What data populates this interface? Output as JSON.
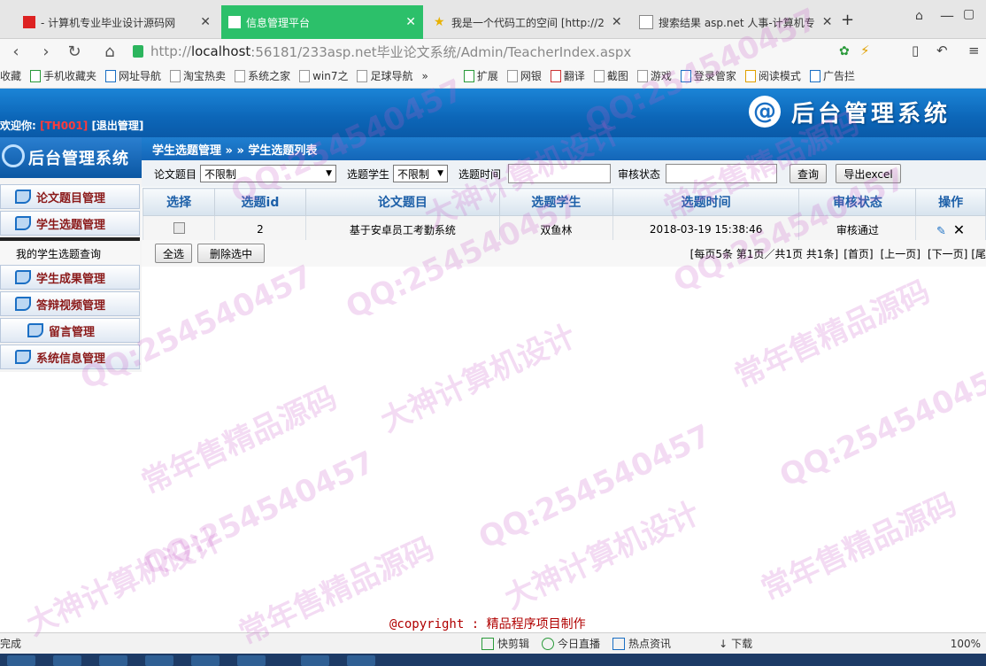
{
  "browser": {
    "tabs": [
      {
        "label": "- 计算机专业毕业设计源码网",
        "active": false
      },
      {
        "label": "信息管理平台",
        "active": true
      },
      {
        "label": "我是一个代码工的空间 [http://2",
        "active": false
      },
      {
        "label": "搜索结果 asp.net 人事-计算机专",
        "active": false
      }
    ],
    "new_tab": "+",
    "url_prefix": "http://",
    "url_host": "localhost",
    "url_rest": ":56181/233asp.net毕业论文系统/Admin/TeacherIndex.aspx",
    "bookmarks": [
      "收藏",
      "手机收藏夹",
      "网址导航",
      "淘宝热卖",
      "系统之家",
      "win7之",
      "足球导航",
      "»"
    ],
    "extensions": [
      "扩展",
      "网银",
      "翻译",
      "截图",
      "游戏",
      "登录管家",
      "阅读模式",
      "广告拦"
    ]
  },
  "header": {
    "welcome_label": "欢迎你:",
    "user_id": "[TH001]",
    "logout": "[退出管理]",
    "system_title": "后台管理系统",
    "logo_symbol": "@"
  },
  "sidebar": {
    "logo_text": "后台管理系统",
    "items": [
      {
        "label": "论文题目管理"
      },
      {
        "label": "学生选题管理"
      },
      {
        "label": "我的学生选题查询"
      },
      {
        "label": "学生成果管理"
      },
      {
        "label": "答辩视频管理"
      },
      {
        "label": "留言管理"
      },
      {
        "label": "系统信息管理"
      }
    ]
  },
  "main": {
    "breadcrumb": "学生选题管理 » » 学生选题列表",
    "filters": {
      "topic_label": "论文题目",
      "topic_value": "不限制",
      "student_label": "选题学生",
      "student_value": "不限制",
      "time_label": "选题时间",
      "status_label": "审核状态",
      "query_button": "查询",
      "export_button": "导出excel"
    },
    "table": {
      "columns": [
        "选择",
        "选题id",
        "论文题目",
        "选题学生",
        "选题时间",
        "审核状态",
        "操作"
      ],
      "rows": [
        {
          "id": "2",
          "topic": "基于安卓员工考勤系统",
          "student": "双鱼林",
          "time": "2018-03-19 15:38:46",
          "status": "审核通过"
        }
      ]
    },
    "select_all_button": "全选",
    "delete_selected_button": "删除选中",
    "pager": {
      "summary": "[每页5条 第1页／共1页 共1条]",
      "first": "[首页]",
      "prev": "[上一页]",
      "next": "[下一页]",
      "last": "[尾"
    }
  },
  "footer": {
    "copyright": "@copyright : 精品程序项目制作"
  },
  "statusbar": {
    "left": "完成",
    "items": [
      "快剪辑",
      "今日直播",
      "热点资讯",
      "下载"
    ],
    "zoom": "100%"
  },
  "watermarks": [
    "QQ:254540457",
    "常年售精品源码",
    "大神计算机设计"
  ],
  "colors": {
    "brand_blue": "#0c66b8",
    "active_tab": "#2cc06a",
    "sidebar_text": "#8b1a1a",
    "header_col": "#1c5fa8",
    "copyright": "#b00000"
  }
}
